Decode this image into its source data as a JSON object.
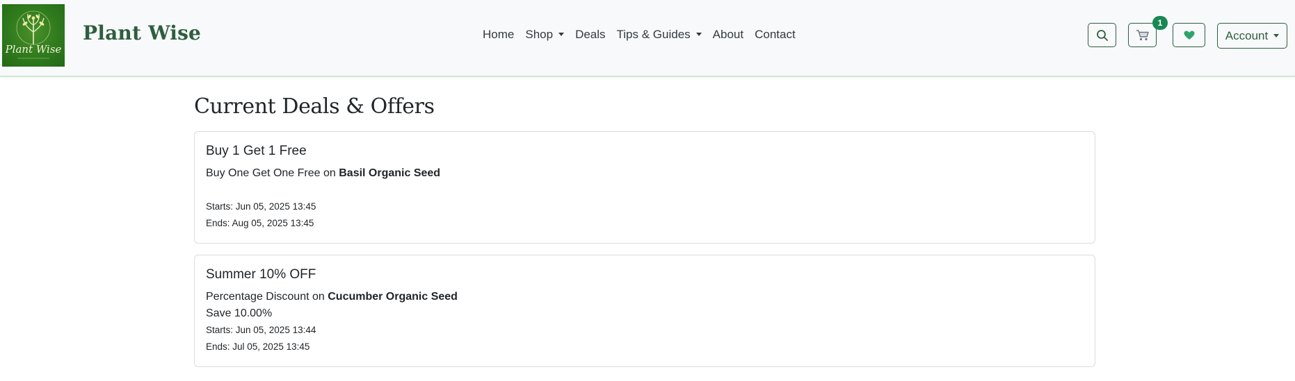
{
  "brand": {
    "name": "Plant Wise",
    "logo_text": "Plant Wise"
  },
  "nav": {
    "items": [
      {
        "label": "Home",
        "dropdown": false
      },
      {
        "label": "Shop",
        "dropdown": true
      },
      {
        "label": "Deals",
        "dropdown": false
      },
      {
        "label": "Tips & Guides",
        "dropdown": true
      },
      {
        "label": "About",
        "dropdown": false
      },
      {
        "label": "Contact",
        "dropdown": false
      }
    ],
    "search_icon": "search-icon",
    "cart_icon": "cart-icon",
    "cart_count": "1",
    "wishlist_icon": "heart-icon",
    "account_label": "Account"
  },
  "colors": {
    "brand_green": "#2e5e3e",
    "badge": "#198754",
    "heart": "#2fa36b",
    "logo_bg": "#2f7a1d"
  },
  "main": {
    "title": "Current Deals & Offers",
    "deals": [
      {
        "title": "Buy 1 Get 1 Free",
        "type": "Buy One Get One Free",
        "on": "on",
        "product": "Basil Organic Seed",
        "save": "",
        "starts": "Starts: Jun 05, 2025 13:45",
        "ends": "Ends: Aug 05, 2025 13:45"
      },
      {
        "title": "Summer 10% OFF",
        "type": "Percentage Discount",
        "on": "on",
        "product": "Cucumber Organic Seed",
        "save": "Save 10.00%",
        "starts": "Starts: Jun 05, 2025 13:44",
        "ends": "Ends: Jul 05, 2025 13:45"
      }
    ]
  }
}
